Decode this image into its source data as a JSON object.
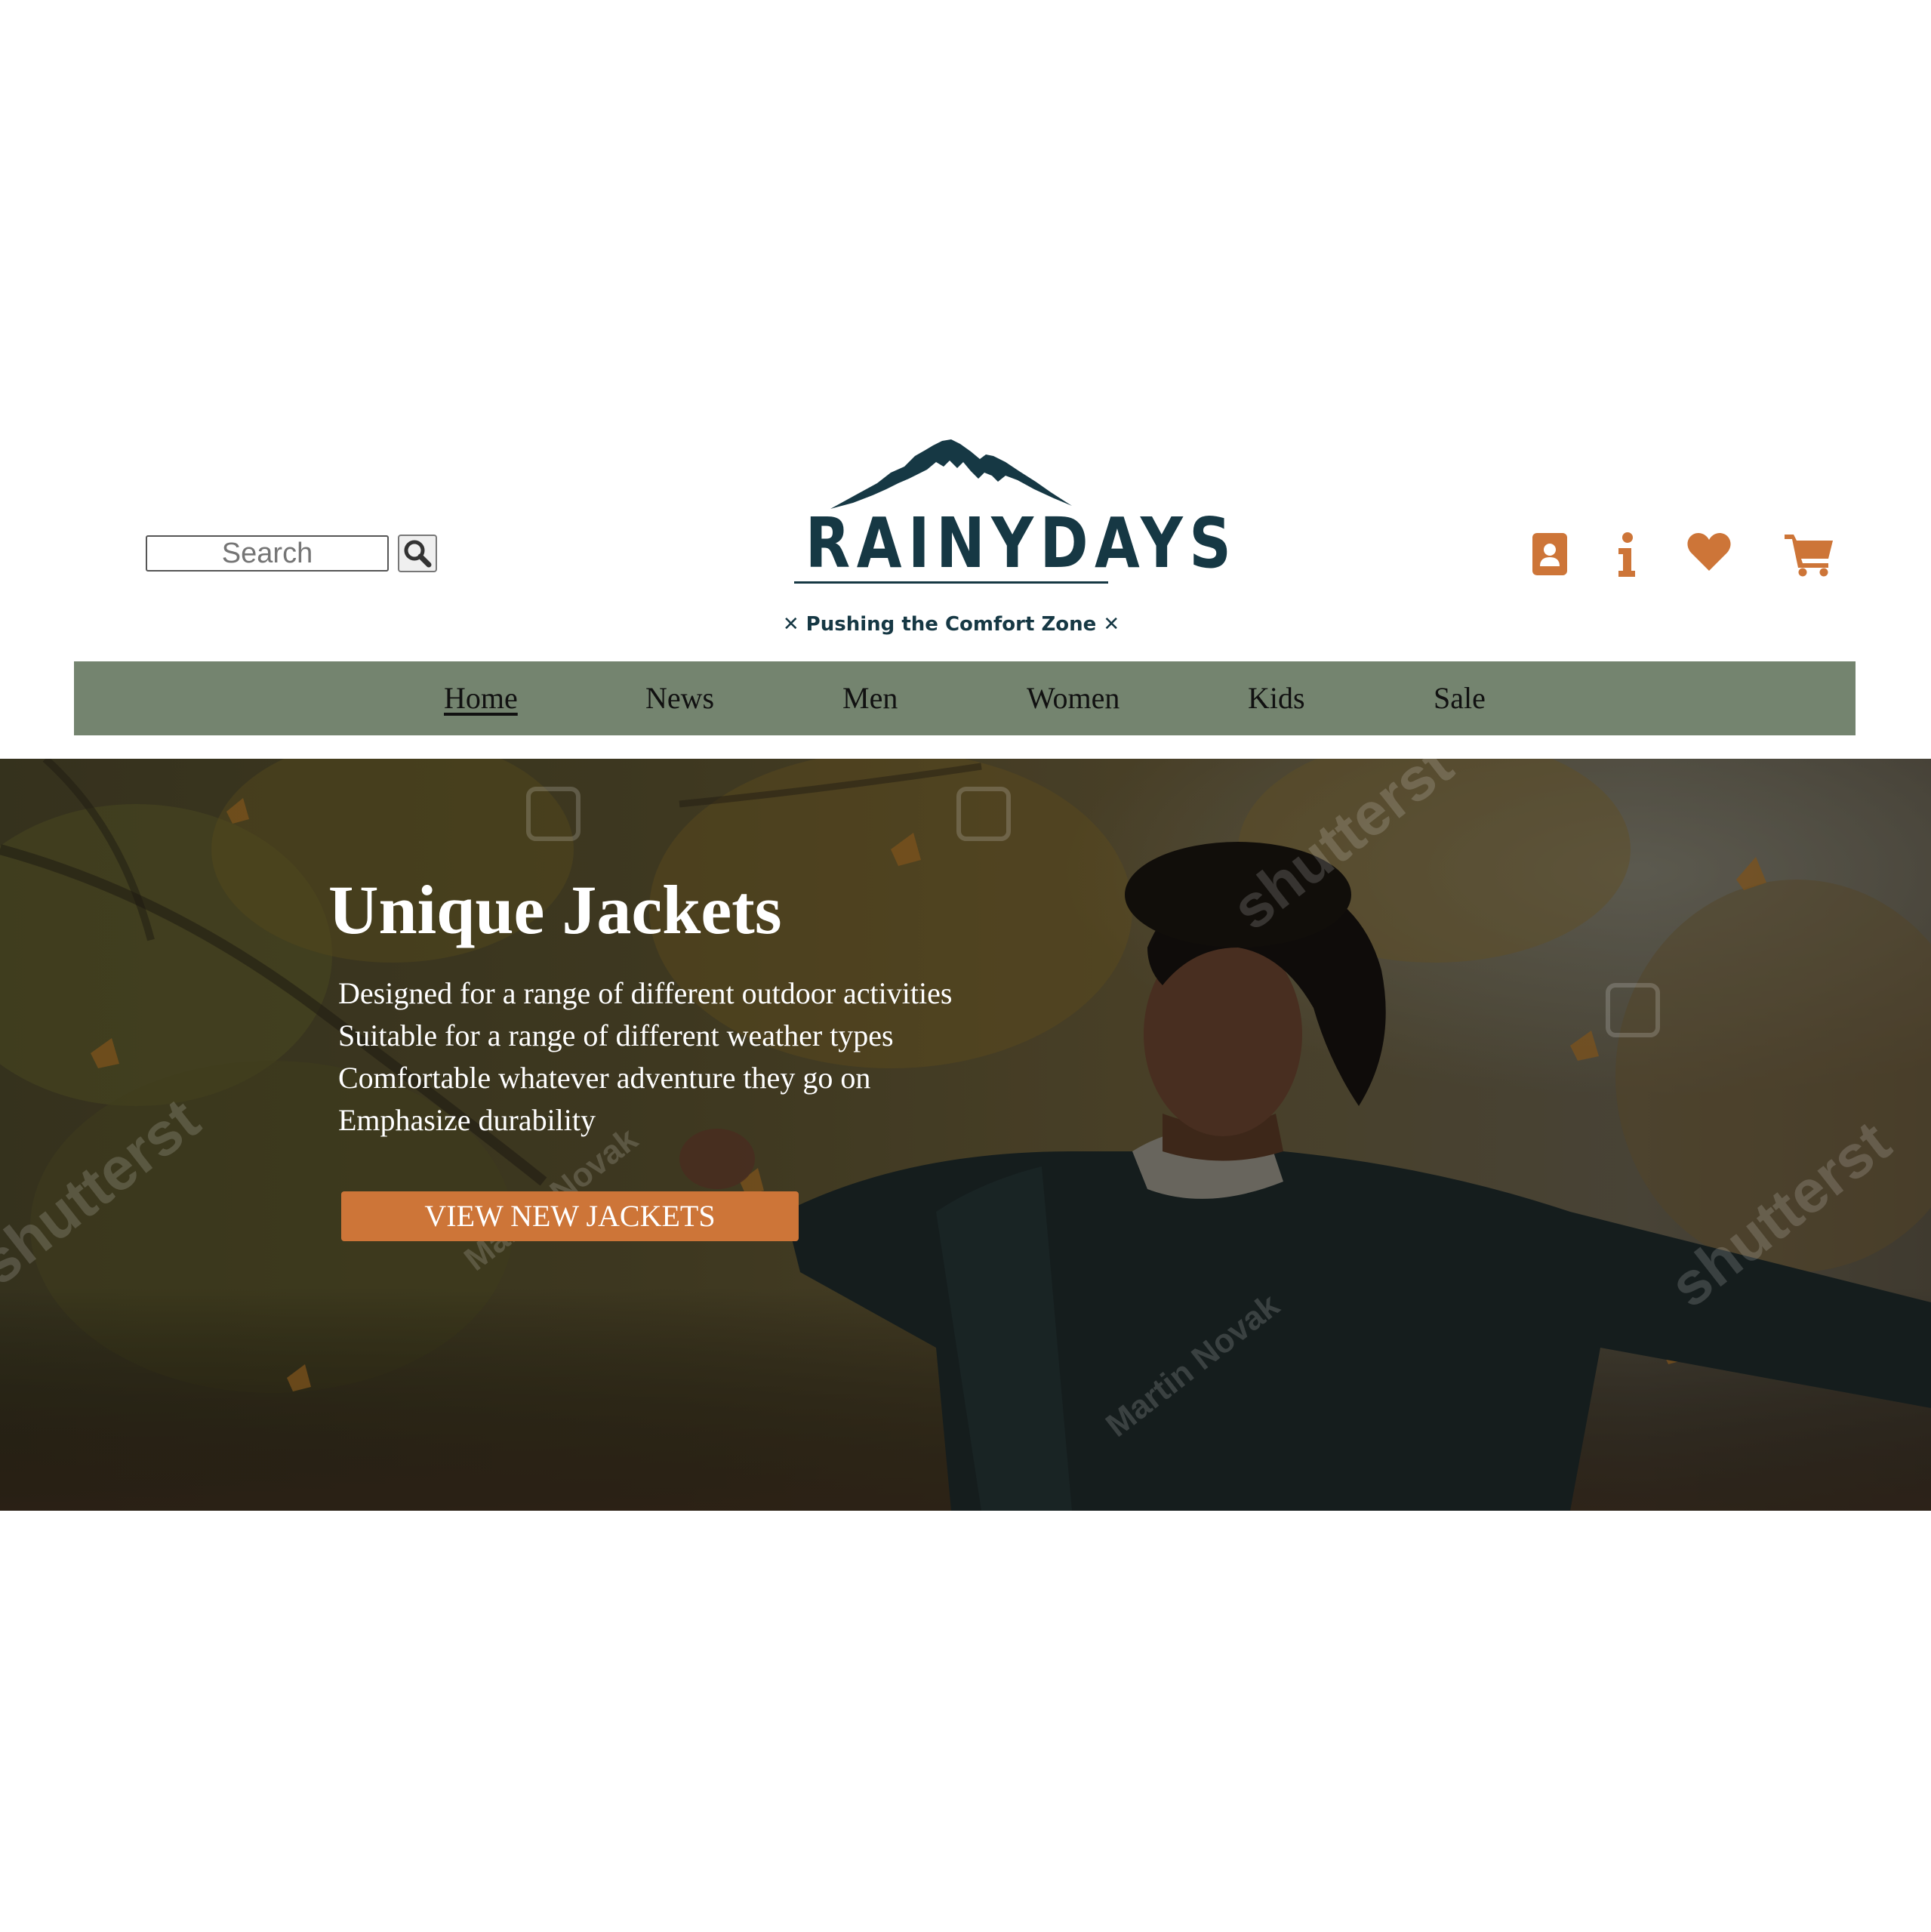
{
  "search": {
    "placeholder": "Search",
    "value": "",
    "icon": "magnifier-icon"
  },
  "logo": {
    "wordmark": "RAINYDAYS",
    "tagline": "✕ Pushing the Comfort Zone ✕",
    "color": "#163844"
  },
  "header_icons": [
    {
      "name": "account-icon"
    },
    {
      "name": "info-icon"
    },
    {
      "name": "favorites-heart-icon"
    },
    {
      "name": "shopping-cart-icon"
    }
  ],
  "nav": {
    "background": "#74846f",
    "items": [
      {
        "label": "Home",
        "active": true
      },
      {
        "label": "News",
        "active": false
      },
      {
        "label": "Men",
        "active": false
      },
      {
        "label": "Women",
        "active": false
      },
      {
        "label": "Kids",
        "active": false
      },
      {
        "label": "Sale",
        "active": false
      }
    ]
  },
  "hero": {
    "title": "Unique Jackets",
    "features": [
      "Designed for a range of different outdoor activities",
      "Suitable for a range of different weather types",
      "Comfortable whatever adventure they go on",
      "Emphasize durability"
    ],
    "cta_label": "VIEW NEW JACKETS",
    "cta_color": "#cd7538",
    "watermarks": [
      "shutterstock",
      "Martin Novak"
    ]
  },
  "colors": {
    "accent": "#cd7538",
    "brand": "#163844",
    "nav": "#74846f"
  }
}
